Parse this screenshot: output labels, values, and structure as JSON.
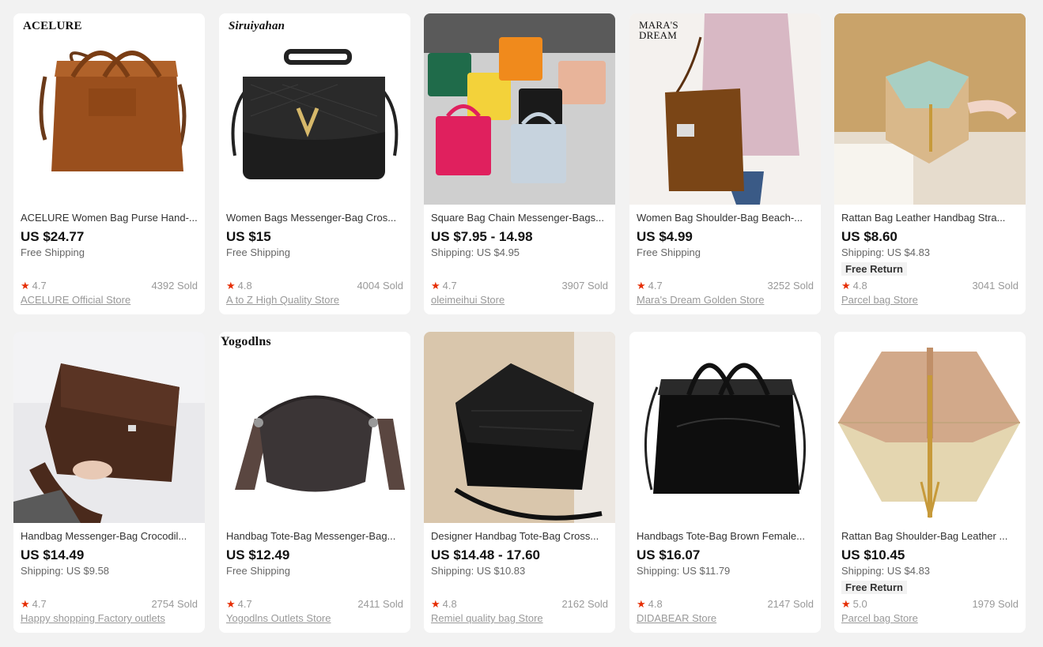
{
  "colors": {
    "background": "#f2f2f2",
    "card": "#ffffff",
    "star": "#e62e04"
  },
  "products": [
    {
      "brand_mark": "ACELURE",
      "title": "ACELURE Women Bag Purse Hand-...",
      "price": "US $24.77",
      "shipping": "Free Shipping",
      "badge": "",
      "rating": "4.7",
      "sold": "4392 Sold",
      "store": "ACELURE Official Store"
    },
    {
      "brand_mark": "Siruiyahan",
      "title": "Women Bags Messenger-Bag Cros...",
      "price": "US $15",
      "shipping": "Free Shipping",
      "badge": "",
      "rating": "4.8",
      "sold": "4004 Sold",
      "store": "A to Z High Quality Store"
    },
    {
      "brand_mark": "",
      "title": "Square Bag Chain Messenger-Bags...",
      "price": "US $7.95 - 14.98",
      "shipping": "Shipping: US $4.95",
      "badge": "",
      "rating": "4.7",
      "sold": "3907 Sold",
      "store": "oleimeihui Store"
    },
    {
      "brand_mark": "MARA'S DREAM",
      "title": "Women Bag Shoulder-Bag Beach-...",
      "price": "US $4.99",
      "shipping": "Free Shipping",
      "badge": "",
      "rating": "4.7",
      "sold": "3252 Sold",
      "store": "Mara's Dream Golden Store"
    },
    {
      "brand_mark": "",
      "title": "Rattan Bag Leather Handbag Stra...",
      "price": "US $8.60",
      "shipping": "Shipping: US $4.83",
      "badge": "Free Return",
      "rating": "4.8",
      "sold": "3041 Sold",
      "store": "Parcel bag Store"
    },
    {
      "brand_mark": "",
      "title": "Handbag Messenger-Bag Crocodil...",
      "price": "US $14.49",
      "shipping": "Shipping: US $9.58",
      "badge": "",
      "rating": "4.7",
      "sold": "2754 Sold",
      "store": "Happy shopping Factory outlets"
    },
    {
      "brand_mark": "Yogodlns",
      "title": "Handbag Tote-Bag Messenger-Bag...",
      "price": "US $12.49",
      "shipping": "Free Shipping",
      "badge": "",
      "rating": "4.7",
      "sold": "2411 Sold",
      "store": "Yogodlns Outlets Store"
    },
    {
      "brand_mark": "",
      "title": "Designer Handbag Tote-Bag Cross...",
      "price": "US $14.48 - 17.60",
      "shipping": "Shipping: US $10.83",
      "badge": "",
      "rating": "4.8",
      "sold": "2162 Sold",
      "store": "Remiel quality bag Store"
    },
    {
      "brand_mark": "",
      "title": "Handbags Tote-Bag Brown Female...",
      "price": "US $16.07",
      "shipping": "Shipping: US $11.79",
      "badge": "",
      "rating": "4.8",
      "sold": "2147 Sold",
      "store": "DIDABEAR Store"
    },
    {
      "brand_mark": "",
      "title": "Rattan Bag Shoulder-Bag Leather ...",
      "price": "US $10.45",
      "shipping": "Shipping: US $4.83",
      "badge": "Free Return",
      "rating": "5.0",
      "sold": "1979 Sold",
      "store": "Parcel bag Store"
    }
  ]
}
